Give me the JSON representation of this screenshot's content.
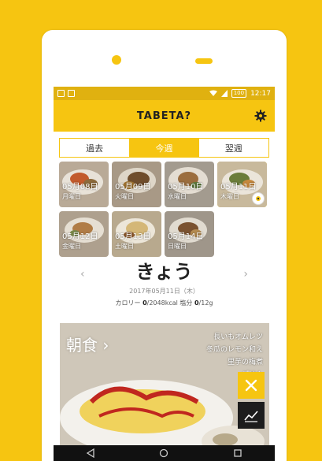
{
  "status_bar": {
    "battery": "100",
    "time": "12:17"
  },
  "app": {
    "title": "TABETA?",
    "settings_icon": "gear-icon"
  },
  "tabs": [
    {
      "label": "過去",
      "active": false
    },
    {
      "label": "今週",
      "active": true
    },
    {
      "label": "翌週",
      "active": false
    }
  ],
  "days": [
    {
      "date": "05月08日",
      "weekday": "月曜日"
    },
    {
      "date": "05月09日",
      "weekday": "火曜日"
    },
    {
      "date": "05月10日",
      "weekday": "水曜日"
    },
    {
      "date": "05月11日",
      "weekday": "木曜日"
    },
    {
      "date": "05月12日",
      "weekday": "金曜日"
    },
    {
      "date": "05月13日",
      "weekday": "土曜日"
    },
    {
      "date": "05月14日",
      "weekday": "日曜日"
    }
  ],
  "day_nav": {
    "prev": "‹",
    "title": "きょう",
    "next": "›",
    "full_date": "2017年05月11日（木）",
    "calorie_label": "カロリー",
    "calorie_value": "0",
    "calorie_total": "/2048kcal",
    "salt_label": "塩分",
    "salt_value": "0",
    "salt_total": "/12g"
  },
  "breakfast": {
    "title": "朝食",
    "chevron": "›",
    "items": [
      "長いもオムレツ",
      "冬瓜のレモン和え",
      "里芋の梅煮",
      "ごはん"
    ]
  },
  "colors": {
    "accent": "#f6c511",
    "dark": "#1d1d1d"
  }
}
